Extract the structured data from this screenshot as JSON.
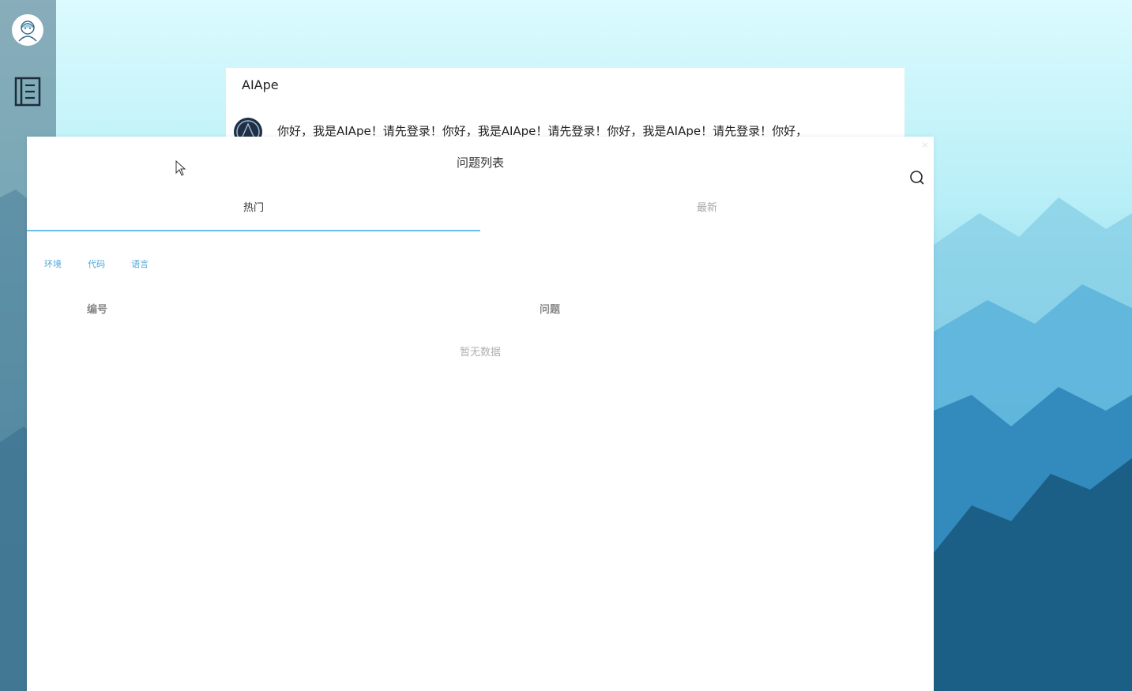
{
  "chat": {
    "title": "AIApe",
    "message": "你好，我是AIApe！请先登录！你好，我是AIApe！请先登录！你好，我是AIApe！请先登录！你好，"
  },
  "modal": {
    "title": "问题列表",
    "tabs": [
      {
        "label": "热门",
        "active": true
      },
      {
        "label": "最新",
        "active": false
      }
    ],
    "filters": [
      "环境",
      "代码",
      "语言"
    ],
    "table": {
      "columns": [
        "编号",
        "问题"
      ],
      "empty_text": "暂无数据"
    }
  },
  "colors": {
    "accent": "#66bff0",
    "filter": "#4fa8d8"
  },
  "icons": {
    "avatar": "user-avatar-icon",
    "sidebar": "book-icon",
    "search": "search-icon"
  }
}
